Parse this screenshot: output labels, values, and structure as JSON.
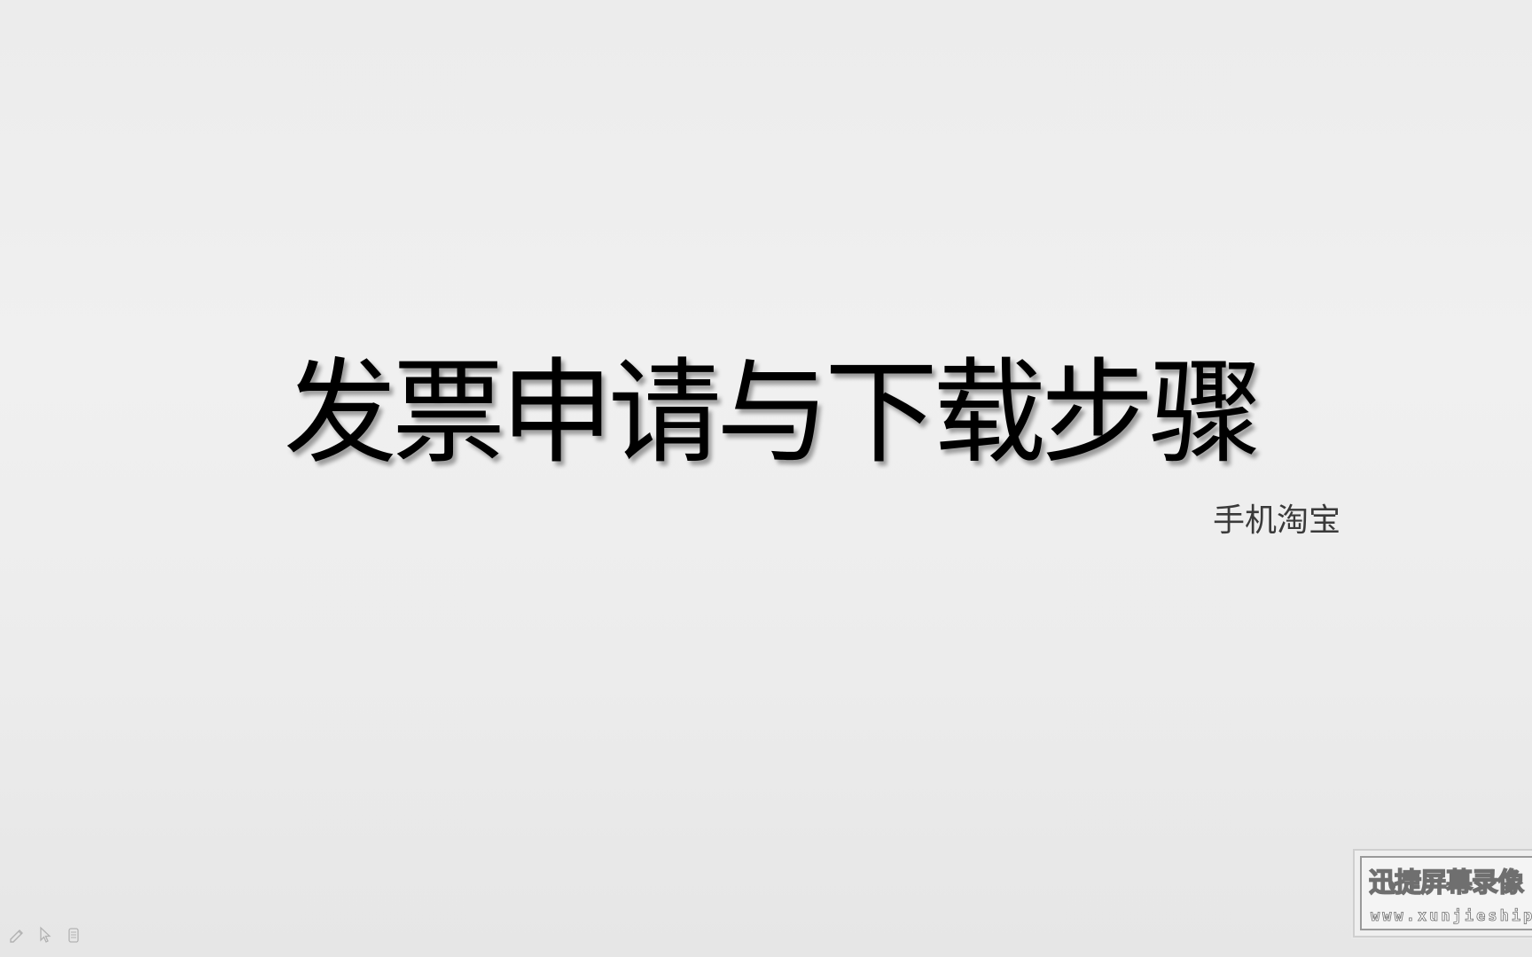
{
  "slide": {
    "title": "发票申请与下载步骤",
    "subtitle": "手机淘宝"
  },
  "presenter_tools": [
    {
      "name": "pen-icon"
    },
    {
      "name": "pointer-icon"
    },
    {
      "name": "slides-icon"
    }
  ],
  "watermark": {
    "app_name": "迅捷屏幕录像",
    "url": "www.xunjieshipin"
  },
  "colors": {
    "background": "#eeeeee",
    "title": "#000000",
    "subtitle": "#3a3a3a"
  }
}
